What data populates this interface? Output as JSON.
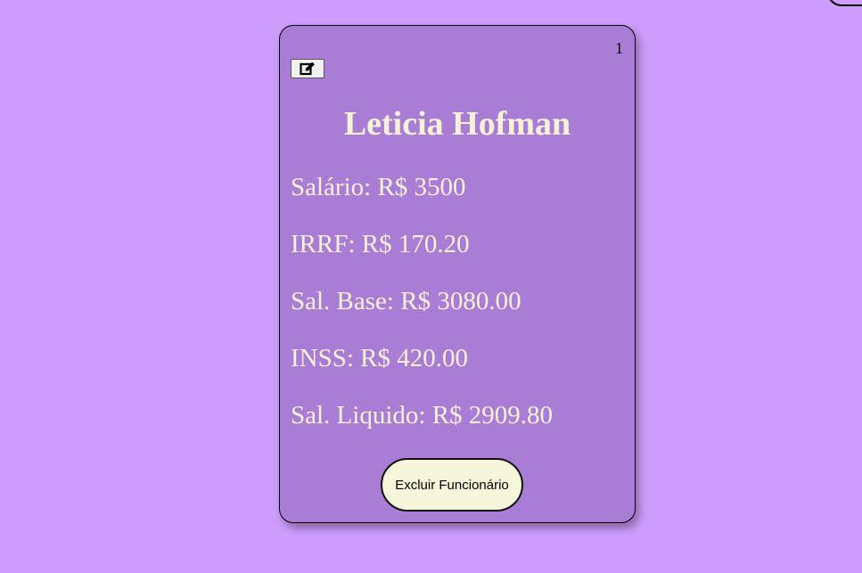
{
  "card": {
    "number": "1",
    "edit_icon": "edit-icon",
    "name": "Leticia Hofman",
    "salary": "Salário: R$ 3500",
    "irrf": "IRRF: R$ 170.20",
    "base_salary": "Sal. Base: R$ 3080.00",
    "inss": "INSS: R$ 420.00",
    "net_salary": "Sal. Liquido: R$ 2909.80",
    "delete_label": "Excluir Funcionário"
  },
  "colors": {
    "background": "#cf9dfd",
    "card": "#a97dd6",
    "text": "#f5f2d8",
    "delete_button": "#f6f6da"
  }
}
